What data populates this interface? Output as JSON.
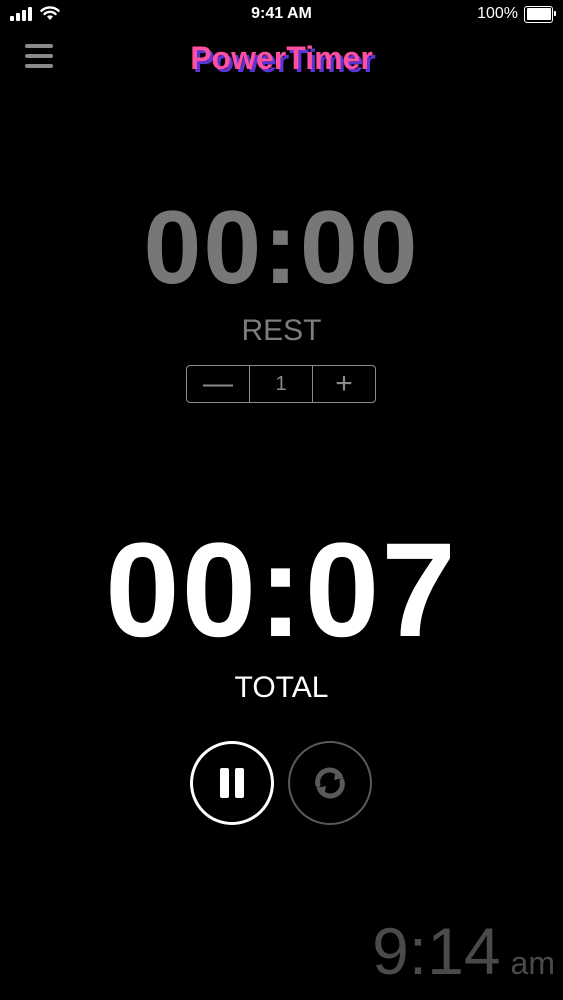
{
  "status_bar": {
    "time": "9:41 AM",
    "battery": "100%",
    "icons": [
      "signal-icon",
      "wifi-icon",
      "battery-icon"
    ]
  },
  "header": {
    "app_name": "PowerTimer",
    "menu_icon": "hamburger-menu-icon"
  },
  "rest": {
    "time": "00:00",
    "label": "REST",
    "stepper": {
      "decrement": "—",
      "value": "1",
      "increment": "+"
    }
  },
  "total": {
    "time": "00:07",
    "label": "TOTAL"
  },
  "controls": {
    "pause_icon": "pause-icon",
    "reset_icon": "reset-icon"
  },
  "clock": {
    "time": "9:14",
    "ampm": "am"
  },
  "colors": {
    "background": "#000000",
    "logo_pink": "#ff4fa3",
    "logo_shadow": "#5a34d6",
    "rest_gray": "#777777",
    "clock_gray": "#4a4a4a"
  }
}
